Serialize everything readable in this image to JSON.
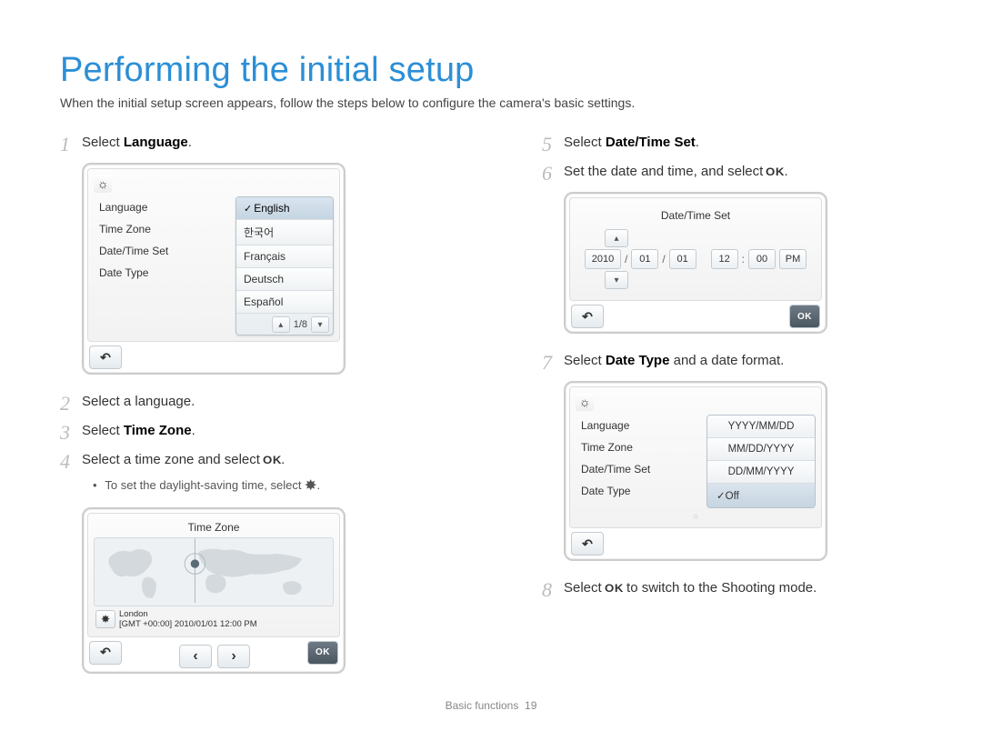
{
  "page_title": "Performing the initial setup",
  "intro": "When the initial setup screen appears, follow the steps below to configure the camera's basic settings.",
  "footer": {
    "section": "Basic functions",
    "page": "19"
  },
  "ok_glyph": "OK",
  "sun_glyph": "✸",
  "left_col": {
    "step1": {
      "pre": "Select ",
      "bold": "Language",
      "post": "."
    },
    "step2": "Select a language.",
    "step3": {
      "pre": "Select ",
      "bold": "Time Zone",
      "post": "."
    },
    "step4": {
      "pre": "Select a time zone and select ",
      "post": "."
    },
    "sub4": {
      "pre": "To set the daylight-saving time, select ",
      "post": "."
    }
  },
  "right_col": {
    "step5": {
      "pre": "Select ",
      "bold": "Date/Time Set",
      "post": "."
    },
    "step6": {
      "pre": "Set the date and time, and select ",
      "post": "."
    },
    "step7": {
      "pre": "Select ",
      "bold": "Date Type",
      "post": " and a date format."
    },
    "step8": {
      "pre": "Select ",
      "post": " to switch to the Shooting mode."
    }
  },
  "lang_screen": {
    "left_items": [
      "Language",
      "Time Zone",
      "Date/Time Set",
      "Date Type"
    ],
    "right_items": [
      "English",
      "한국어",
      "Français",
      "Deutsch",
      "Español"
    ],
    "selected_index": 0,
    "pager": "1/8"
  },
  "tz_screen": {
    "title": "Time Zone",
    "city": "London",
    "gmt": "[GMT +00:00]",
    "datetime": "2010/01/01 12:00 PM"
  },
  "datetime_screen": {
    "title": "Date/Time Set",
    "year": "2010",
    "month": "01",
    "day": "01",
    "hour": "12",
    "minute": "00",
    "ampm": "PM"
  },
  "datetype_screen": {
    "left_items": [
      "Language",
      "Time Zone",
      "Date/Time Set",
      "Date Type"
    ],
    "options": [
      "YYYY/MM/DD",
      "MM/DD/YYYY",
      "DD/MM/YYYY",
      "Off"
    ],
    "selected_index": 3
  }
}
